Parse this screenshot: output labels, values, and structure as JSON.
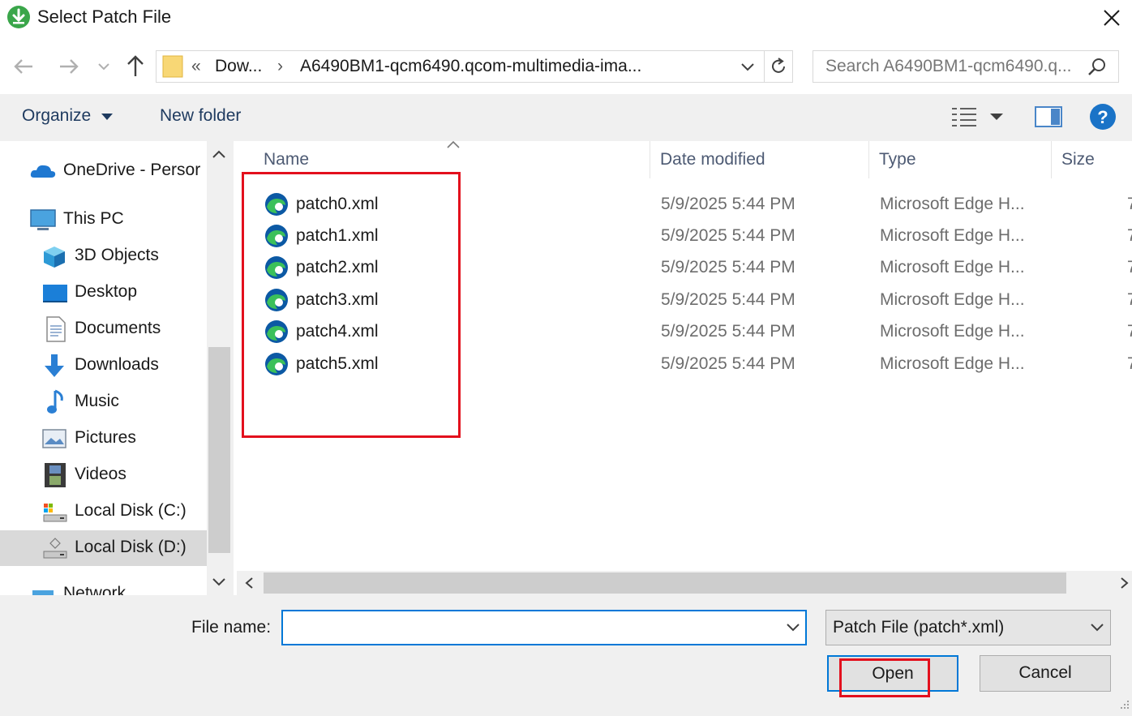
{
  "window": {
    "title": "Select Patch File"
  },
  "address": {
    "overflow": "«",
    "crumb1": "Dow...",
    "separator": "›",
    "crumb2": "A6490BM1-qcm6490.qcom-multimedia-ima..."
  },
  "search": {
    "placeholder": "Search A6490BM1-qcm6490.q..."
  },
  "toolbar": {
    "organize_label": "Organize",
    "new_folder_label": "New folder"
  },
  "sidebar": {
    "items": [
      {
        "label": "OneDrive - Persor",
        "icon": "cloud-icon"
      },
      {
        "label": "This PC",
        "icon": "computer-icon"
      },
      {
        "label": "3D Objects",
        "icon": "cube-icon"
      },
      {
        "label": "Desktop",
        "icon": "desktop-icon"
      },
      {
        "label": "Documents",
        "icon": "document-icon"
      },
      {
        "label": "Downloads",
        "icon": "download-arrow-icon"
      },
      {
        "label": "Music",
        "icon": "music-note-icon"
      },
      {
        "label": "Pictures",
        "icon": "picture-icon"
      },
      {
        "label": "Videos",
        "icon": "film-icon"
      },
      {
        "label": "Local Disk (C:)",
        "icon": "drive-icon"
      },
      {
        "label": "Local Disk (D:)",
        "icon": "drive-icon",
        "selected": true
      },
      {
        "label": "Network",
        "icon": "network-icon"
      }
    ]
  },
  "columns": {
    "name": "Name",
    "date": "Date modified",
    "type": "Type",
    "size": "Size"
  },
  "files": [
    {
      "name": "patch0.xml",
      "date": "5/9/2025 5:44 PM",
      "type": "Microsoft Edge H...",
      "size": "7"
    },
    {
      "name": "patch1.xml",
      "date": "5/9/2025 5:44 PM",
      "type": "Microsoft Edge H...",
      "size": "7"
    },
    {
      "name": "patch2.xml",
      "date": "5/9/2025 5:44 PM",
      "type": "Microsoft Edge H...",
      "size": "7"
    },
    {
      "name": "patch3.xml",
      "date": "5/9/2025 5:44 PM",
      "type": "Microsoft Edge H...",
      "size": "7"
    },
    {
      "name": "patch4.xml",
      "date": "5/9/2025 5:44 PM",
      "type": "Microsoft Edge H...",
      "size": "7"
    },
    {
      "name": "patch5.xml",
      "date": "5/9/2025 5:44 PM",
      "type": "Microsoft Edge H...",
      "size": "7"
    }
  ],
  "bottom": {
    "file_name_label": "File name:",
    "file_name_value": "",
    "filter_value": "Patch File (patch*.xml)",
    "open_label": "Open",
    "cancel_label": "Cancel"
  },
  "colors": {
    "accent": "#0078d7",
    "highlight": "#e3101d",
    "edge_blue": "#0c59a4",
    "edge_green": "#3bc05a"
  }
}
